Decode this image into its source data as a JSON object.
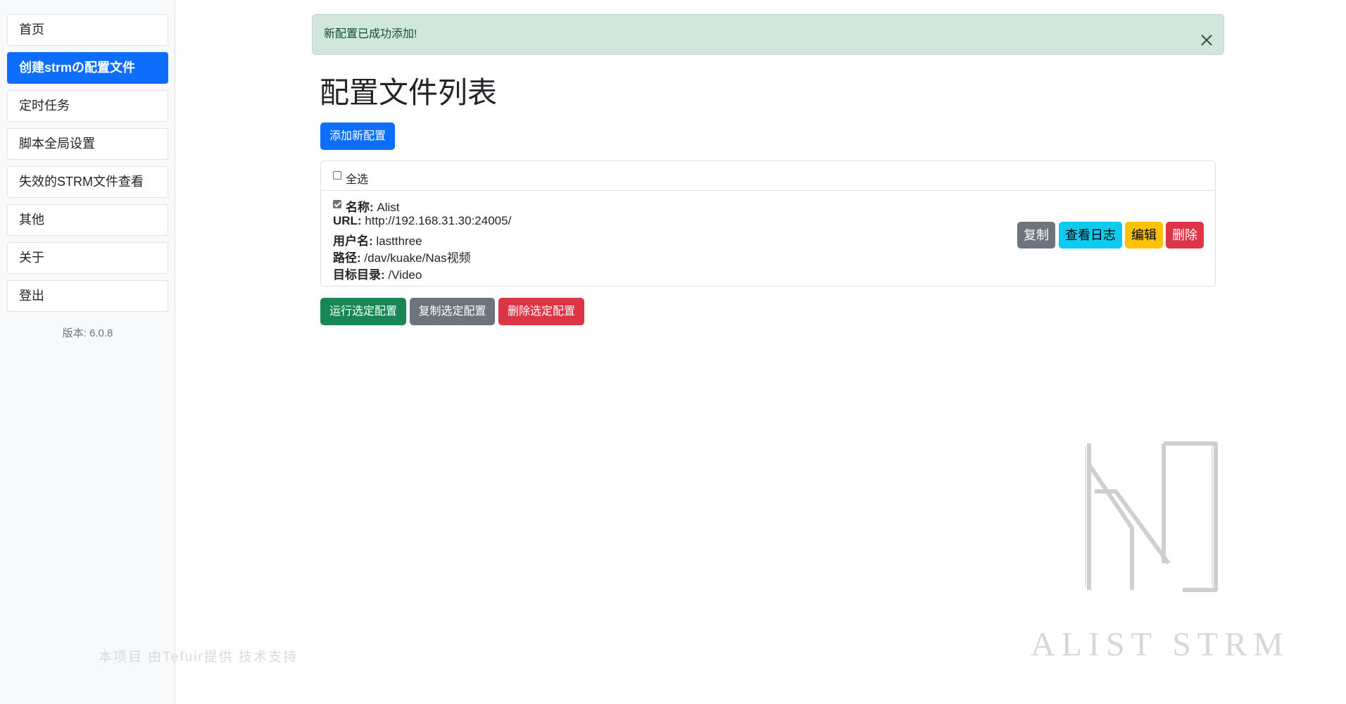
{
  "sidebar": {
    "items": [
      {
        "label": "首页"
      },
      {
        "label": "创建strmの配置文件",
        "active": true
      },
      {
        "label": "定时任务"
      },
      {
        "label": "脚本全局设置"
      },
      {
        "label": "失效的STRM文件查看"
      },
      {
        "label": "其他"
      },
      {
        "label": "关于"
      },
      {
        "label": "登出"
      }
    ],
    "version": "版本: 6.0.8",
    "credit": "本项目 由Tefuir提供 技术支持"
  },
  "alert": {
    "message": "新配置已成功添加!",
    "close_icon": "close-icon"
  },
  "page_title": "配置文件列表",
  "add_button": "添加新配置",
  "select_all": {
    "label": "全选",
    "checked": false
  },
  "config": {
    "checked": true,
    "name_label": "名称:",
    "name": "Alist",
    "url_label": "URL:",
    "url": "http://192.168.31.30:24005/",
    "user_label": "用户名:",
    "user": "lastthree",
    "path_label": "路径:",
    "path": "/dav/kuake/Nas视频",
    "target_label": "目标目录:",
    "target": "/Video",
    "actions": {
      "copy": "复制",
      "logs": "查看日志",
      "edit": "编辑",
      "delete": "删除"
    }
  },
  "bulk_actions": {
    "run": "运行选定配置",
    "copy": "复制选定配置",
    "delete": "删除选定配置"
  },
  "logo_text": "ALIST STRM",
  "colors": {
    "primary": "#0d6efd",
    "success": "#198754",
    "secondary": "#6c757d",
    "danger": "#dc3545",
    "info": "#0dcaf0",
    "warning": "#ffc107",
    "alert_bg": "#d1e7dd"
  }
}
